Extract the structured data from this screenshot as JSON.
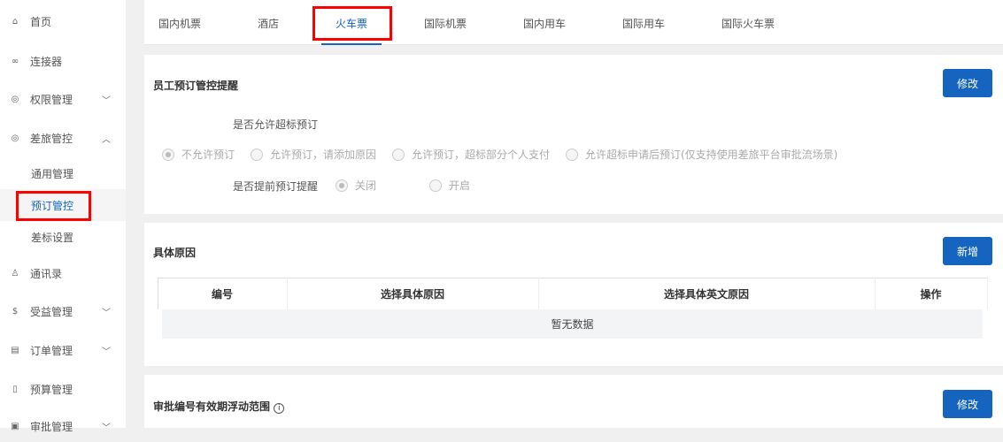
{
  "sidebar": {
    "items": [
      {
        "label": "首页",
        "icon": "home-icon"
      },
      {
        "label": "连接器",
        "icon": "link-icon"
      },
      {
        "label": "权限管理",
        "icon": "gear-icon"
      },
      {
        "label": "差旅管控",
        "icon": "gear-icon"
      },
      {
        "label": "通用管理"
      },
      {
        "label": "预订管控"
      },
      {
        "label": "差标设置"
      },
      {
        "label": "通讯录",
        "icon": "contacts-icon"
      },
      {
        "label": "受益管理",
        "icon": "coin-icon"
      },
      {
        "label": "订单管理",
        "icon": "order-icon"
      },
      {
        "label": "预算管理",
        "icon": "document-icon"
      },
      {
        "label": "审批管理",
        "icon": "approval-icon"
      }
    ]
  },
  "tabs": [
    "国内机票",
    "酒店",
    "火车票",
    "国际机票",
    "国内用车",
    "国际用车",
    "国际火车票"
  ],
  "booking": {
    "title": "员工预订管控提醒",
    "button": "修改",
    "allow_label": "是否允许超标预订",
    "options": [
      "不允许预订",
      "允许预订，请添加原因",
      "允许预订，超标部分个人支付",
      "允许超标申请后预订(仅支持使用差旅平台审批流场景)"
    ],
    "remind_label": "是否提前预订提醒",
    "remind_options": [
      "关闭",
      "开启"
    ]
  },
  "reasons": {
    "title": "具体原因",
    "button": "新增",
    "columns": [
      "编号",
      "选择具体原因",
      "选择具体英文原因",
      "操作"
    ],
    "empty": "暂无数据"
  },
  "approval": {
    "title": "审批编号有效期浮动范围",
    "button": "修改"
  }
}
